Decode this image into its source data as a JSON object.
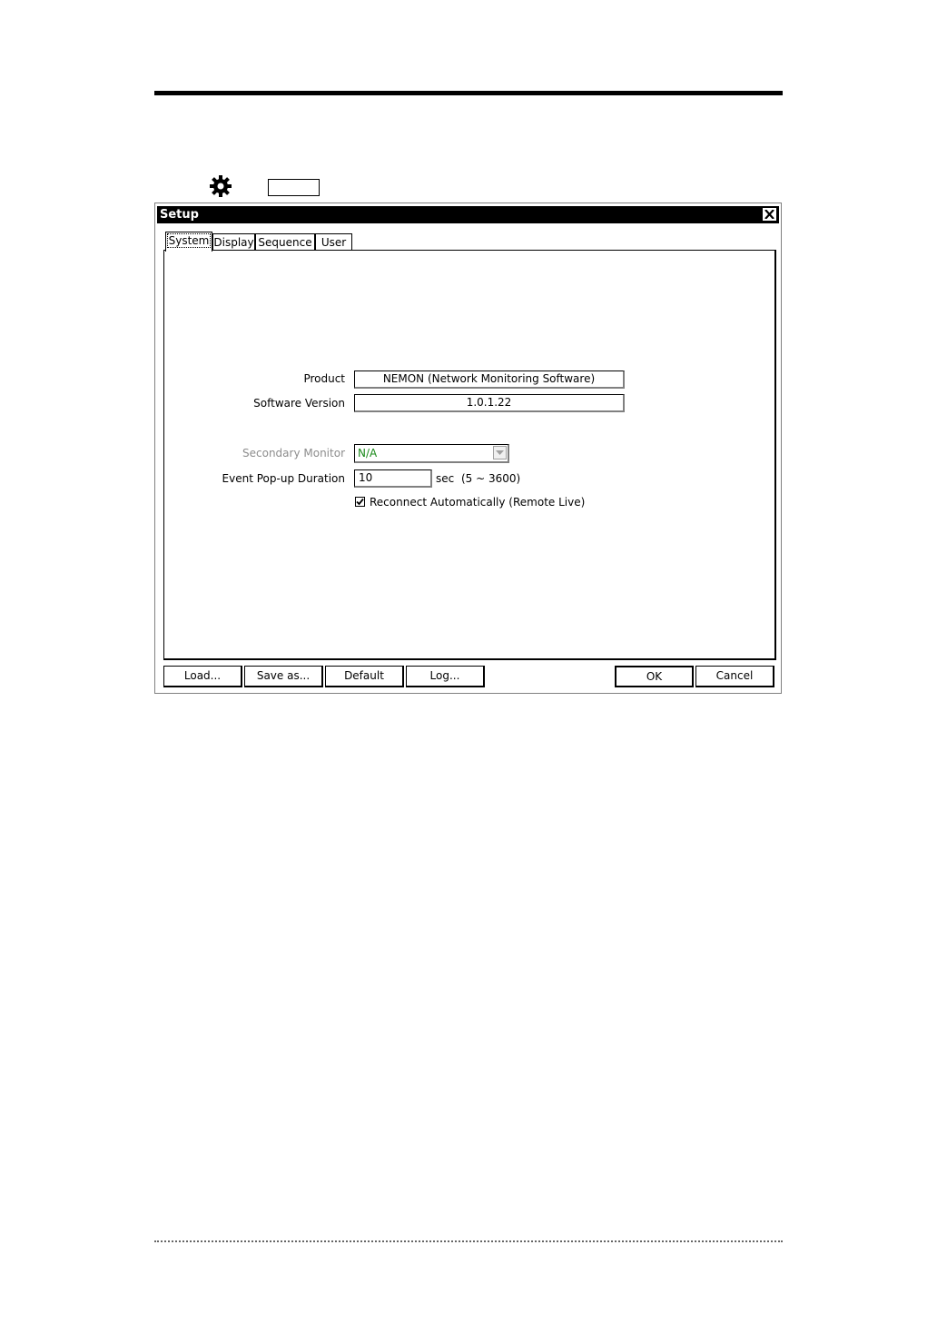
{
  "page": {
    "gear_icon": "gear-icon"
  },
  "dialog": {
    "title": "Setup",
    "close_icon": "close-icon",
    "tabs": [
      {
        "label": "System",
        "active": true
      },
      {
        "label": "Display",
        "active": false
      },
      {
        "label": "Sequence",
        "active": false
      },
      {
        "label": "User",
        "active": false
      }
    ],
    "system": {
      "product_label": "Product",
      "product_value": "NEMON (Network Monitoring Software)",
      "version_label": "Software Version",
      "version_value": "1.0.1.22",
      "secondary_monitor_label": "Secondary Monitor",
      "secondary_monitor_value": "N/A",
      "popup_duration_label": "Event Pop-up Duration",
      "popup_duration_value": "10",
      "popup_duration_unit": "sec",
      "popup_duration_range": "(5 ~ 3600)",
      "reconnect_label": "Reconnect Automatically (Remote Live)",
      "reconnect_checked": true
    },
    "buttons": {
      "load": "Load...",
      "save_as": "Save as...",
      "default": "Default",
      "log": "Log...",
      "ok": "OK",
      "cancel": "Cancel"
    }
  }
}
